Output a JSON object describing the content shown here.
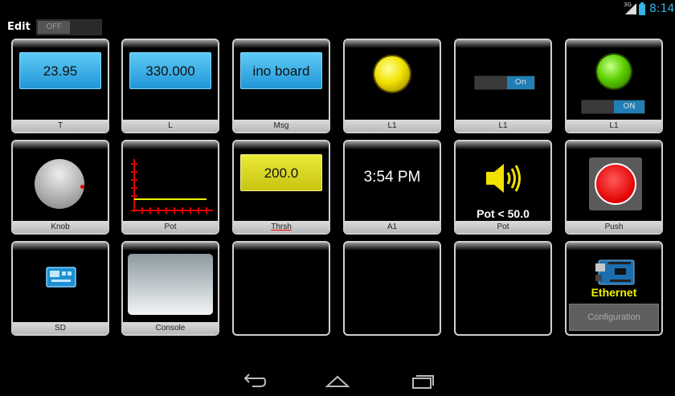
{
  "statusbar": {
    "network": "3G",
    "time": "8:14"
  },
  "edit": {
    "label": "Edit",
    "toggle_state": "OFF"
  },
  "tiles": {
    "t": {
      "value": "23.95",
      "label": "T"
    },
    "l": {
      "value": "330.000",
      "label": "L"
    },
    "msg": {
      "value": "ino board",
      "label": "Msg"
    },
    "led_yellow": {
      "label": "L1"
    },
    "switch_l1": {
      "state": "On",
      "label": "L1"
    },
    "led_green": {
      "state": "ON",
      "label": "L1"
    },
    "knob": {
      "label": "Knob"
    },
    "pot_chart": {
      "label": "Pot"
    },
    "thrsh": {
      "value": "200.0",
      "label": "Thrsh"
    },
    "a1": {
      "value": "3:54 PM",
      "label": "A1"
    },
    "pot_alarm": {
      "text": "Pot < 50.0",
      "label": "Pot"
    },
    "push": {
      "label": "Push"
    },
    "sd": {
      "label": "SD"
    },
    "console": {
      "label": "Console"
    },
    "ethernet": {
      "text": "Ethernet",
      "button": "Configuration"
    }
  },
  "colors": {
    "accent": "#33b5e5",
    "display_blue": "#2196d8",
    "display_yellow": "#d6d220",
    "text_yellow": "#f2f200"
  }
}
